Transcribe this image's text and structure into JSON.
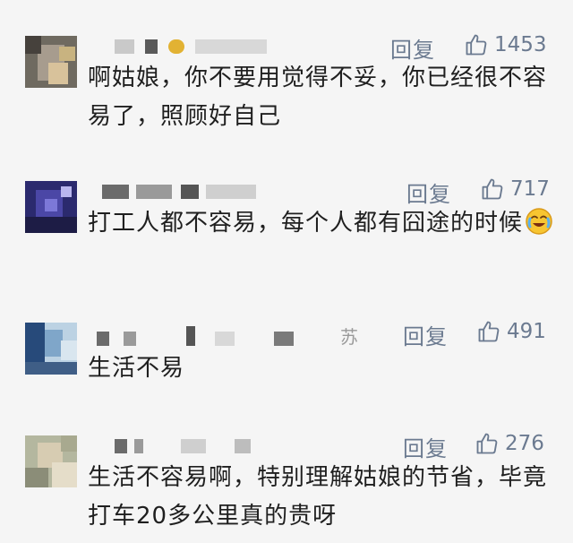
{
  "comments": [
    {
      "avatar_colors": [
        "#6f6a60",
        "#a79c8e",
        "#d8c29b",
        "#46413c",
        "#c8b380"
      ],
      "username_suffix": "",
      "reply_label": "回复",
      "likes": "1453",
      "text": "啊姑娘，你不要用觉得不妥，你已经很不容易了，照顾好自己",
      "emoji": ""
    },
    {
      "avatar_colors": [
        "#2b2a6e",
        "#4b47a6",
        "#7c78d8",
        "#1d1c45",
        "#b9b6ee"
      ],
      "username_suffix": "",
      "reply_label": "回复",
      "likes": "717",
      "text": "打工人都不容易，每个人都有囧途的时候",
      "emoji": "crying-laughing-emoji"
    },
    {
      "avatar_colors": [
        "#274a7a",
        "#7fa6c9",
        "#d9e6ef",
        "#3f5e86",
        "#bcd2e3"
      ],
      "username_suffix": "苏",
      "reply_label": "回复",
      "likes": "491",
      "text": "生活不易",
      "emoji": ""
    },
    {
      "avatar_colors": [
        "#b4b79f",
        "#d7ccb2",
        "#8b8d78",
        "#e5ddc9",
        "#a8a98f"
      ],
      "username_suffix": "",
      "reply_label": "回复",
      "likes": "276",
      "text": "生活不容易啊，特别理解姑娘的节省，毕竟打车20多公里真的贵呀",
      "emoji": ""
    }
  ]
}
